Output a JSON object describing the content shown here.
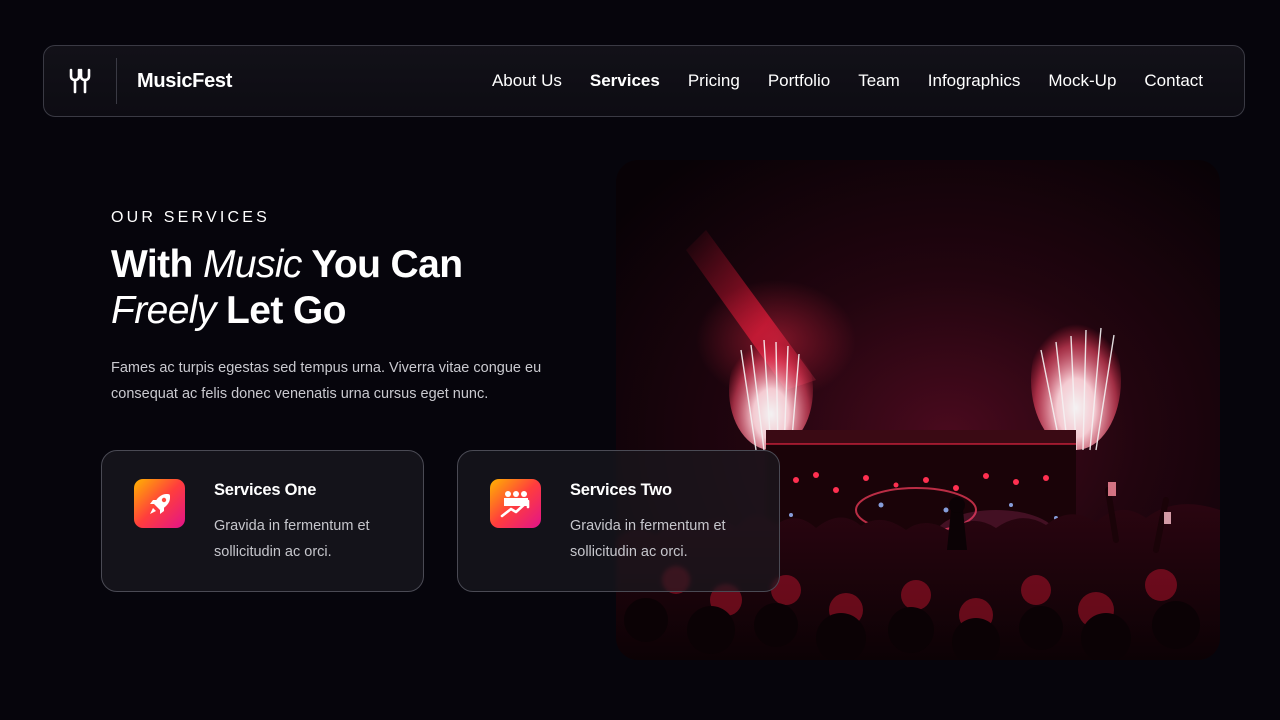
{
  "nav": {
    "logo_icon": "music-fork-logo-icon",
    "brand": "MusicFest",
    "links": [
      "About Us",
      "Services",
      "Pricing",
      "Portfolio",
      "Team",
      "Infographics",
      "Mock-Up",
      "Contact"
    ],
    "active_link": "Services"
  },
  "hero": {
    "eyebrow": "OUR SERVICES",
    "headline": {
      "w1": "With",
      "w2": "Music",
      "w3": "You Can",
      "w4": "Freely",
      "w5": "Let Go"
    },
    "description": "Fames ac turpis egestas sed tempus urna. Viverra vitae congue eu consequat ac felis donec venenatis urna cursus eget nunc.",
    "image_subject": "concert-crowd-fireworks-photo"
  },
  "services": [
    {
      "title": "Services One",
      "text": "Gravida in fermentum et sollicitudin ac orci.",
      "icon": "rocket-icon"
    },
    {
      "title": "Services Two",
      "text": "Gravida in fermentum et sollicitudin ac orci.",
      "icon": "team-growth-icon"
    }
  ],
  "colors": {
    "background": "#06050c",
    "accent_gradient_start": "#ffb400",
    "accent_gradient_mid": "#ff3d3d",
    "accent_gradient_end": "#e2138a",
    "stage_red": "#ff1a3c"
  }
}
